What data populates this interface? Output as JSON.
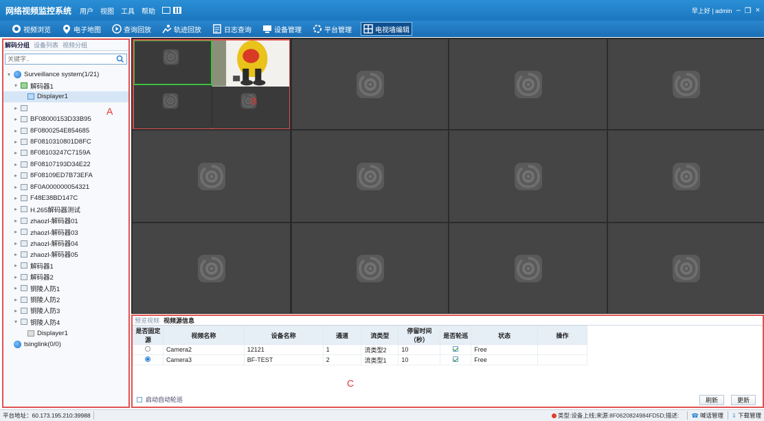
{
  "titlebar": {
    "app_title": "网络视频监控系统",
    "menus": [
      "用户",
      "视图",
      "工具",
      "帮助"
    ],
    "greeting": "早上好 | admin"
  },
  "toolbar": {
    "items": [
      {
        "label": "视频浏览",
        "icon": "camera-icon"
      },
      {
        "label": "电子地图",
        "icon": "map-pin-icon"
      },
      {
        "label": "查询回放",
        "icon": "play-icon"
      },
      {
        "label": "轨迹回放",
        "icon": "track-icon"
      },
      {
        "label": "日志查询",
        "icon": "log-icon"
      },
      {
        "label": "设备管理",
        "icon": "device-icon"
      },
      {
        "label": "平台管理",
        "icon": "platform-icon"
      },
      {
        "label": "电视墙编辑",
        "icon": "tv-wall-icon"
      }
    ],
    "active": "电视墙编辑"
  },
  "sidebar": {
    "tabs": [
      "解码分组",
      "设备列表",
      "视频分组"
    ],
    "active_tab": "解码分组",
    "search_placeholder": "关键字..",
    "tree": [
      {
        "label": "Surveillance system(1/21)",
        "type": "root",
        "indent": 0,
        "toggle": "▾"
      },
      {
        "label": "解码器1",
        "type": "device-online",
        "indent": 1,
        "toggle": "▾"
      },
      {
        "label": "Displayer1",
        "type": "display",
        "indent": 2,
        "toggle": "",
        "selected": true
      },
      {
        "label": "",
        "type": "device",
        "indent": 1,
        "toggle": "▸"
      },
      {
        "label": "BF08000153D33B95",
        "type": "device",
        "indent": 1,
        "toggle": "▸"
      },
      {
        "label": "8F0800254E854685",
        "type": "device",
        "indent": 1,
        "toggle": "▸"
      },
      {
        "label": "8F0810310801D8FC",
        "type": "device",
        "indent": 1,
        "toggle": "▸"
      },
      {
        "label": "8F08103247C7159A",
        "type": "device",
        "indent": 1,
        "toggle": "▸"
      },
      {
        "label": "8F08107193D34E22",
        "type": "device",
        "indent": 1,
        "toggle": "▸"
      },
      {
        "label": "8F08109ED7B73EFA",
        "type": "device",
        "indent": 1,
        "toggle": "▸"
      },
      {
        "label": "8F0A000000054321",
        "type": "device",
        "indent": 1,
        "toggle": "▸"
      },
      {
        "label": "F48E38BD147C",
        "type": "device",
        "indent": 1,
        "toggle": "▸"
      },
      {
        "label": "H.265解码器测试",
        "type": "device",
        "indent": 1,
        "toggle": "▸"
      },
      {
        "label": "zhaozl-解码器01",
        "type": "device",
        "indent": 1,
        "toggle": "▸"
      },
      {
        "label": "zhaozl-解码器03",
        "type": "device",
        "indent": 1,
        "toggle": "▸"
      },
      {
        "label": "zhaozl-解码器04",
        "type": "device",
        "indent": 1,
        "toggle": "▸"
      },
      {
        "label": "zhaozl-解码器05",
        "type": "device",
        "indent": 1,
        "toggle": "▸"
      },
      {
        "label": "解码器1",
        "type": "device",
        "indent": 1,
        "toggle": "▸"
      },
      {
        "label": "解码器2",
        "type": "device",
        "indent": 1,
        "toggle": "▸"
      },
      {
        "label": "铜陵人防1",
        "type": "device",
        "indent": 1,
        "toggle": "▸"
      },
      {
        "label": "铜陵人防2",
        "type": "device",
        "indent": 1,
        "toggle": "▸"
      },
      {
        "label": "铜陵人防3",
        "type": "device",
        "indent": 1,
        "toggle": "▸"
      },
      {
        "label": "铜陵人防4",
        "type": "device",
        "indent": 1,
        "toggle": "▾"
      },
      {
        "label": "Displayer1",
        "type": "display-gray",
        "indent": 2,
        "toggle": ""
      },
      {
        "label": "tsinglink(0/0)",
        "type": "root",
        "indent": 0,
        "toggle": ""
      }
    ]
  },
  "annotations": {
    "a": "A",
    "b": "B",
    "c": "C"
  },
  "video_grid": {
    "rows": 3,
    "cols": 4,
    "selected_cell": "1-1",
    "selected_split": "2x2"
  },
  "bottom": {
    "tabs": [
      "预览视频",
      "视频源信息"
    ],
    "active_tab": "视频源信息",
    "columns": [
      "是否固定源",
      "视频名称",
      "设备名称",
      "通道",
      "流类型",
      "停留时间（秒）",
      "是否轮巡",
      "状态",
      "操作"
    ],
    "rows": [
      {
        "fixed": false,
        "name": "Camera2",
        "device": "12121",
        "channel": "1",
        "stream": "流类型2",
        "dwell": "10",
        "poll": true,
        "status": "Free"
      },
      {
        "fixed": true,
        "name": "Camera3",
        "device": "BF-TEST",
        "channel": "2",
        "stream": "流类型1",
        "dwell": "10",
        "poll": true,
        "status": "Free"
      }
    ],
    "auto_poll_label": "启动自动轮巡",
    "refresh_label": "刷新",
    "update_label": "更新"
  },
  "statusbar": {
    "platform_address": "平台地址：60.173.195.210:39988",
    "alert": "类型:设备上线;来源:8F0620824984FD5D;描述:",
    "intercom": "喊话管理",
    "download": "下载管理"
  }
}
